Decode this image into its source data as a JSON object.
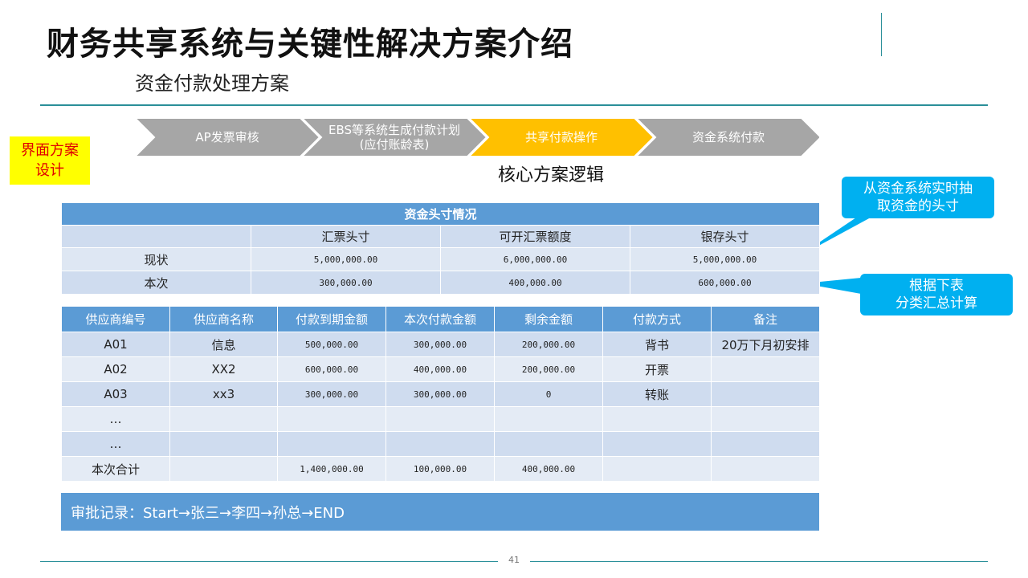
{
  "header": {
    "title": "财务共享系统与关键性解决方案介绍",
    "subtitle": "资金付款处理方案"
  },
  "label_box": {
    "line1": "界面方案",
    "line2": "设计"
  },
  "process": {
    "steps": [
      {
        "line1": "AP发票审核",
        "line2": ""
      },
      {
        "line1": "EBS等系统生成付款计划",
        "line2": "(应付账龄表)"
      },
      {
        "line1": "共享付款操作",
        "line2": ""
      },
      {
        "line1": "资金系统付款",
        "line2": ""
      }
    ],
    "colors": {
      "normal": "#a6a6a6",
      "active": "#ffc000"
    },
    "active_index": 2,
    "caption": "核心方案逻辑"
  },
  "callouts": {
    "top": {
      "line1": "从资金系统实时抽",
      "line2": "取资金的头寸"
    },
    "bottom": {
      "line1": "根据下表",
      "line2": "分类汇总计算"
    },
    "color": "#00b0f0"
  },
  "fund_table": {
    "caption": "资金头寸情况",
    "headers": [
      "",
      "汇票头寸",
      "可开汇票额度",
      "银存头寸"
    ],
    "rows": [
      [
        "现状",
        "5,000,000.00",
        "6,000,000.00",
        "5,000,000.00"
      ],
      [
        "本次",
        "300,000.00",
        "400,000.00",
        "600,000.00"
      ]
    ]
  },
  "supplier_table": {
    "headers": [
      "供应商编号",
      "供应商名称",
      "付款到期金额",
      "本次付款金额",
      "剩余金额",
      "付款方式",
      "备注"
    ],
    "rows": [
      [
        "A01",
        "信息",
        "500,000.00",
        "300,000.00",
        "200,000.00",
        "背书",
        "20万下月初安排"
      ],
      [
        "A02",
        "XX2",
        "600,000.00",
        "400,000.00",
        "200,000.00",
        "开票",
        ""
      ],
      [
        "A03",
        "xx3",
        "300,000.00",
        "300,000.00",
        "0",
        "转账",
        ""
      ],
      [
        "…",
        "",
        "",
        "",
        "",
        "",
        ""
      ],
      [
        "…",
        "",
        "",
        "",
        "",
        "",
        ""
      ],
      [
        "本次合计",
        "",
        "1,400,000.00",
        "100,000.00",
        "400,000.00",
        "",
        ""
      ]
    ]
  },
  "approval": {
    "text": "审批记录：Start→张三→李四→孙总→END"
  },
  "footer": {
    "page_number": "41"
  },
  "theme": {
    "teal": "#2a8f99",
    "table_header": "#5b9bd5",
    "highlight": "#ffff00"
  }
}
